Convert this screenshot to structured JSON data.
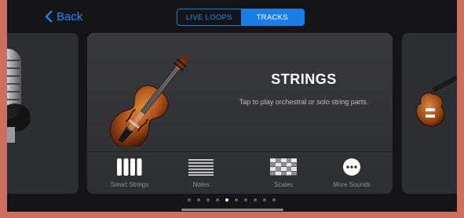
{
  "nav": {
    "back_label": "Back"
  },
  "segments": [
    {
      "label": "LIVE LOOPS",
      "selected": false
    },
    {
      "label": "TRACKS",
      "selected": true
    }
  ],
  "instrument": {
    "title": "STRINGS",
    "subtitle": "Tap to play orchestral or solo string parts."
  },
  "options": [
    {
      "label": "Smart Strings",
      "icon": "smart-strings-icon"
    },
    {
      "label": "Notes",
      "icon": "notes-icon"
    },
    {
      "label": "Scales",
      "icon": "scales-icon"
    },
    {
      "label": "More Sounds",
      "icon": "more-sounds-icon"
    }
  ],
  "carousel": {
    "page_count": 10,
    "current_page": 4
  },
  "colors": {
    "accent": "#1a7ee8",
    "background": "#151517",
    "card": "#2d2e31",
    "frame": "#cf6f60"
  }
}
